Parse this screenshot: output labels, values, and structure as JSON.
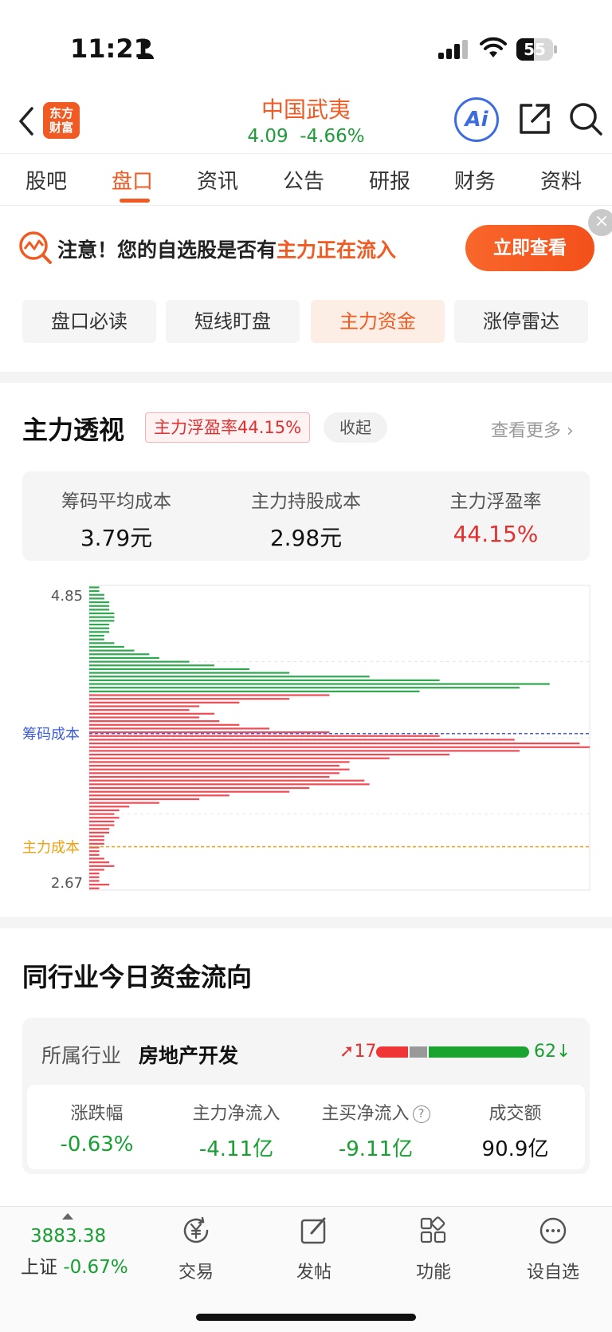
{
  "status": {
    "time": "11:21",
    "battery": "55"
  },
  "header": {
    "logo_line1": "东方",
    "logo_line2": "财富",
    "stock_name": "中国武夷",
    "price": "4.09",
    "change": "-4.66%",
    "ai_label": "Ai"
  },
  "tabs": [
    {
      "label": "股吧"
    },
    {
      "label": "盘口"
    },
    {
      "label": "资讯"
    },
    {
      "label": "公告"
    },
    {
      "label": "研报"
    },
    {
      "label": "财务"
    },
    {
      "label": "资料"
    }
  ],
  "banner": {
    "text_prefix": "注意！您的自选股是否有",
    "text_highlight": "主力正在流入",
    "button": "立即查看"
  },
  "subtabs": [
    {
      "label": "盘口必读"
    },
    {
      "label": "短线盯盘"
    },
    {
      "label": "主力资金"
    },
    {
      "label": "涨停雷达"
    }
  ],
  "main_force": {
    "title": "主力透视",
    "badge": "主力浮盈率44.15%",
    "collapse": "收起",
    "more": "查看更多 ›",
    "stats": [
      {
        "label": "筹码平均成本",
        "value": "3.79元"
      },
      {
        "label": "主力持股成本",
        "value": "2.98元"
      },
      {
        "label": "主力浮盈率",
        "value": "44.15%"
      }
    ]
  },
  "chart_data": {
    "type": "bar",
    "orientation": "horizontal",
    "y_top_label": "4.85",
    "y_bottom_label": "2.67",
    "ylim": [
      2.67,
      4.85
    ],
    "lines": [
      {
        "name": "筹码成本",
        "value": 3.79,
        "color": "#3d5ee0"
      },
      {
        "name": "主力成本",
        "value": 2.98,
        "color": "#f0a010"
      }
    ],
    "current_price": 4.09,
    "profit_color": "#2fa84f",
    "loss_color": "#ee4b55",
    "series": [
      {
        "name": "chips",
        "values": [
          0.02,
          0.02,
          0.03,
          0.03,
          0.04,
          0.04,
          0.04,
          0.05,
          0.05,
          0.05,
          0.04,
          0.04,
          0.04,
          0.03,
          0.03,
          0.05,
          0.07,
          0.09,
          0.12,
          0.14,
          0.2,
          0.25,
          0.32,
          0.4,
          0.56,
          0.7,
          0.92,
          0.86,
          0.66,
          0.48,
          0.4,
          0.3,
          0.22,
          0.2,
          0.25,
          0.22,
          0.26,
          0.3,
          0.36,
          0.48,
          0.7,
          0.85,
          0.98,
          1.0,
          0.86,
          0.72,
          0.6,
          0.52,
          0.5,
          0.52,
          0.5,
          0.48,
          0.55,
          0.56,
          0.44,
          0.4,
          0.28,
          0.22,
          0.14,
          0.08,
          0.06,
          0.05,
          0.06,
          0.05,
          0.05,
          0.04,
          0.04,
          0.03,
          0.03,
          0.03,
          0.02,
          0.02,
          0.02,
          0.03,
          0.04,
          0.05,
          0.03,
          0.02,
          0.02,
          0.02,
          0.04,
          0.02
        ]
      }
    ]
  },
  "industry": {
    "title": "同行业今日资金流向",
    "label": "所属行业",
    "value": "房地产开发",
    "up": "17",
    "down": "62",
    "stats": [
      {
        "label": "涨跌幅",
        "value": "-0.63%"
      },
      {
        "label": "主力净流入",
        "value": "-4.11亿"
      },
      {
        "label": "主买净流入",
        "value": "-9.11亿"
      },
      {
        "label": "成交额",
        "value": "90.9亿"
      }
    ]
  },
  "bottom_nav": {
    "index_value": "3883.38",
    "index_name": "上证",
    "index_change": "-0.67%",
    "items": [
      {
        "label": "交易",
        "icon": "yen-icon"
      },
      {
        "label": "发帖",
        "icon": "edit-icon"
      },
      {
        "label": "功能",
        "icon": "grid-icon"
      },
      {
        "label": "设自选",
        "icon": "more-icon"
      }
    ]
  }
}
